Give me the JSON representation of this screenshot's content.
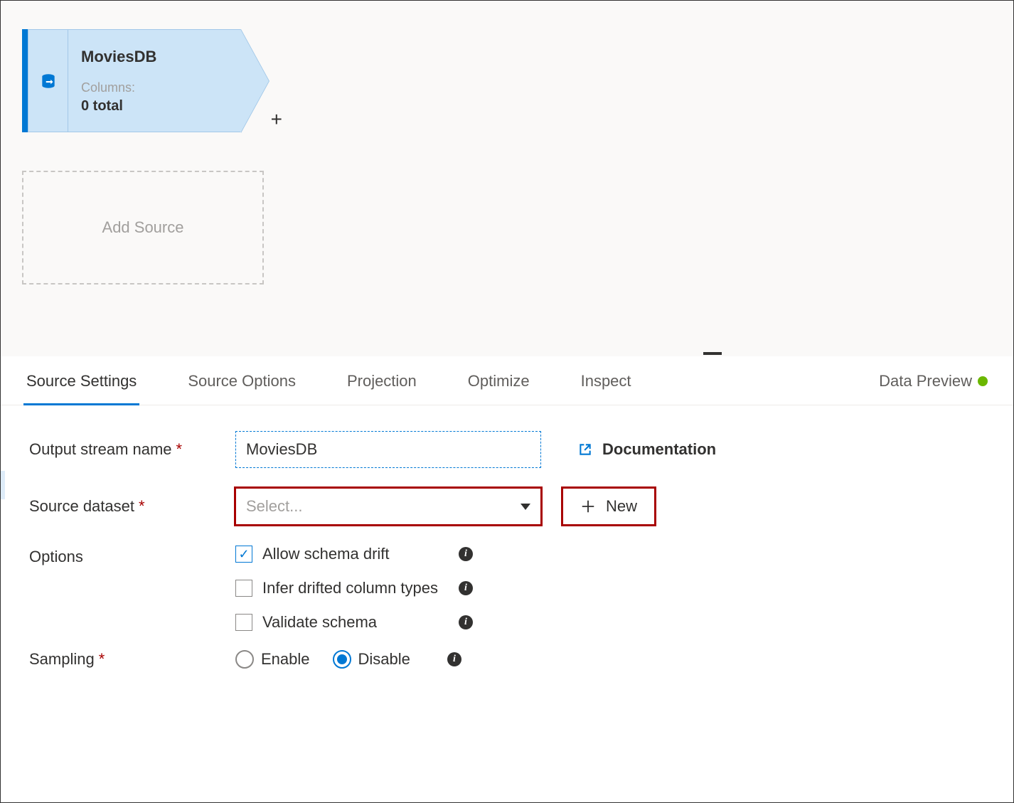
{
  "source_node": {
    "title": "MoviesDB",
    "columns_label": "Columns:",
    "columns_count": "0 total"
  },
  "add_source_label": "Add Source",
  "tabs": [
    {
      "label": "Source Settings",
      "active": true
    },
    {
      "label": "Source Options",
      "active": false
    },
    {
      "label": "Projection",
      "active": false
    },
    {
      "label": "Optimize",
      "active": false
    },
    {
      "label": "Inspect",
      "active": false
    },
    {
      "label": "Data Preview",
      "active": false
    }
  ],
  "form": {
    "output_stream": {
      "label": "Output stream name",
      "value": "MoviesDB"
    },
    "source_dataset": {
      "label": "Source dataset",
      "placeholder": "Select..."
    },
    "options_label": "Options",
    "options": [
      {
        "label": "Allow schema drift",
        "checked": true
      },
      {
        "label": "Infer drifted column types",
        "checked": false
      },
      {
        "label": "Validate schema",
        "checked": false
      }
    ],
    "sampling": {
      "label": "Sampling",
      "enable": "Enable",
      "disable": "Disable",
      "selected": "disable"
    },
    "documentation_label": "Documentation",
    "new_label": "New"
  }
}
